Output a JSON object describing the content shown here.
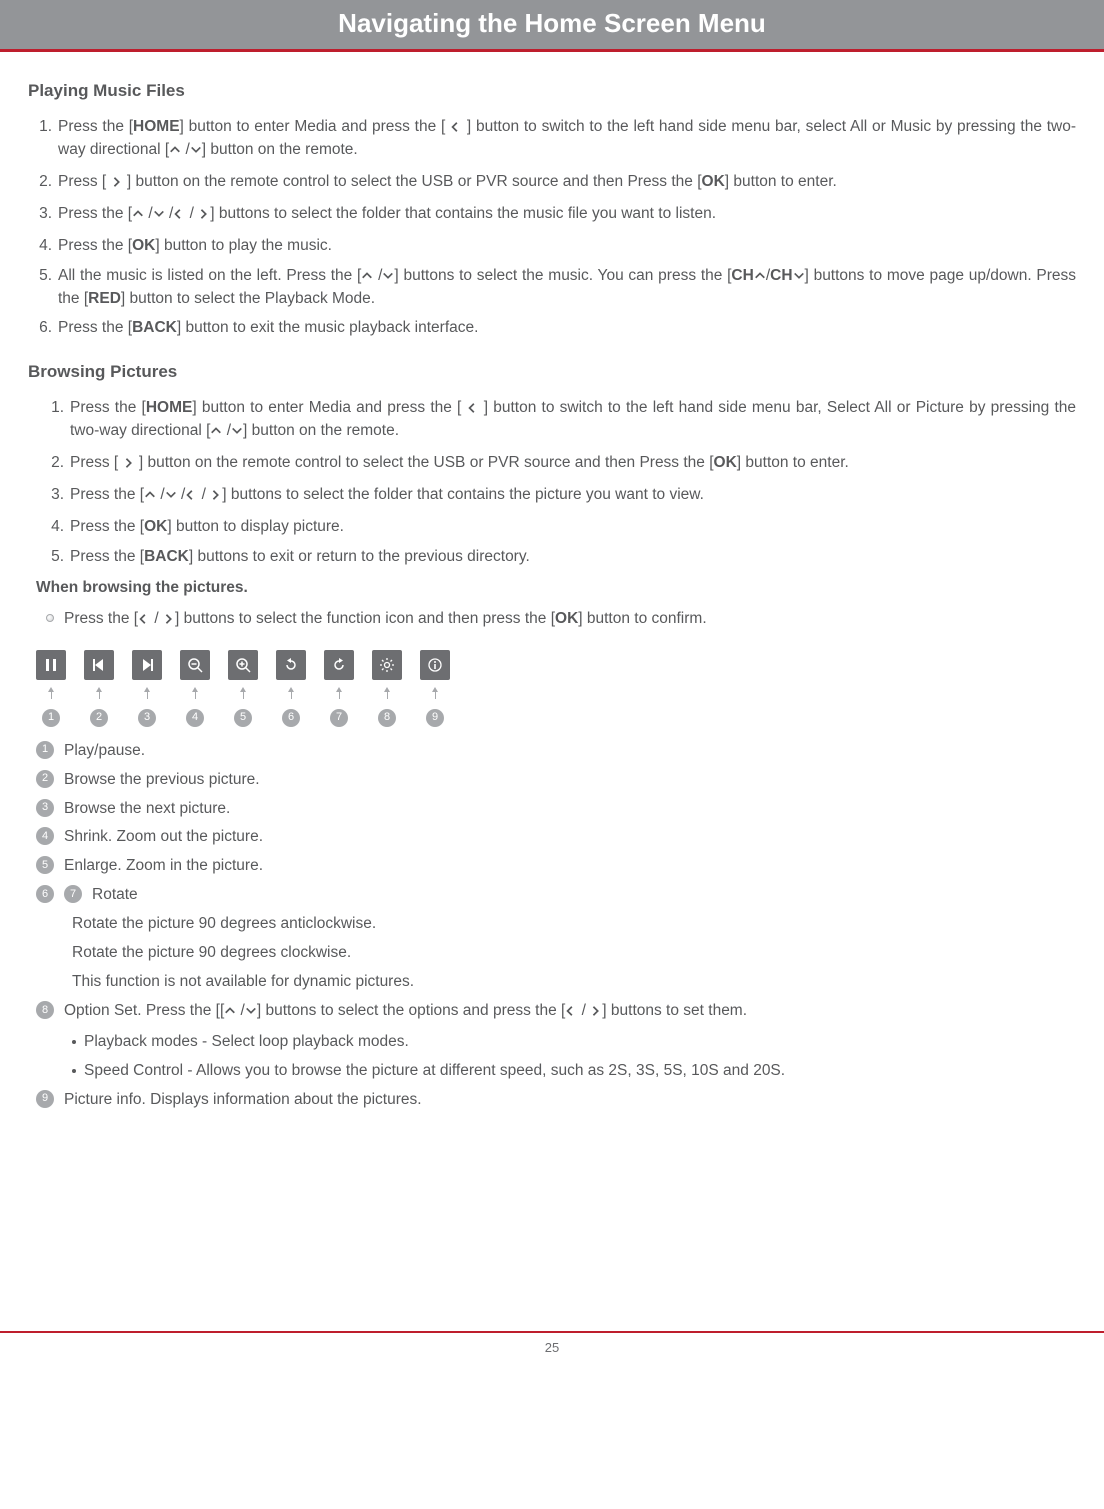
{
  "header": {
    "title": "Navigating the Home Screen Menu"
  },
  "section_music": {
    "title": "Playing Music Files",
    "steps": [
      {
        "pre": "Press the [",
        "b1": "HOME",
        "mid1": "] button to enter Media and press the [ ",
        "icon1": "left",
        "mid2": " ] button to switch to the left hand side menu bar, select All or Music by pressing the two-way directional [",
        "icon2": "up",
        "mid3": " /",
        "icon3": "down",
        "post": "] button on the remote."
      },
      {
        "pre": "Press [ ",
        "icon1": "right",
        "mid1": " ] button on the remote control to select the USB or PVR source and then Press the [",
        "b1": "OK",
        "post": "] button to enter."
      },
      {
        "pre": "Press the [",
        "icon1": "up",
        "mid1": " /",
        "icon2": "down",
        "mid2": " /",
        "icon3": "left",
        "mid3": " / ",
        "icon4": "right",
        "post": "] buttons to select the folder that contains the music file you want to listen."
      },
      {
        "pre": "Press the [",
        "b1": "OK",
        "post": "] button to play the music."
      },
      {
        "pre": "All the music is listed on the left. Press the [",
        "icon1": "up",
        "mid1": " /",
        "icon2": "down",
        "mid2": "] buttons to select the music. You can press the [",
        "b1": "CH",
        "icon3": "up",
        "mid3": "/",
        "b2": "CH",
        "icon4": "down",
        "mid4": "] buttons to move page up/down. Press the [",
        "b3": "RED",
        "post": "] button to select the Playback Mode."
      },
      {
        "pre": "Press the [",
        "b1": "BACK",
        "post": "] button to exit the music playback interface."
      }
    ]
  },
  "section_pics": {
    "title": "Browsing Pictures",
    "steps": [
      {
        "pre": "Press the [",
        "b1": "HOME",
        "mid1": "] button to enter Media and press the [ ",
        "icon1": "left",
        "mid2": " ] button to switch to the left hand side menu bar, Select All or Picture by pressing the two-way directional [",
        "icon2": "up",
        "mid3": " /",
        "icon3": "down",
        "post": "] button on the remote."
      },
      {
        "pre": "Press [ ",
        "icon1": "right",
        "mid1": " ] button on the remote control to select the USB or PVR source and then Press the [",
        "b1": "OK",
        "post": "] button to enter."
      },
      {
        "pre": "Press the  [",
        "icon1": "up",
        "mid1": " /",
        "icon2": "down",
        "mid2": " /",
        "icon3": "left",
        "mid3": " / ",
        "icon4": "right",
        "post": "] buttons to select the folder that contains the picture you want to view."
      },
      {
        "pre": "Press the [",
        "b1": "OK",
        "post": "] button to display picture."
      },
      {
        "pre": "Press the [",
        "b1": "BACK",
        "post": "] buttons to exit or return to the previous directory."
      }
    ],
    "sub_heading": "When browsing the pictures.",
    "bullet": {
      "pre": "Press the [",
      "icon1": "left",
      "mid1": " / ",
      "icon2": "right",
      "mid2": "] buttons to select the function icon and then press the [",
      "b1": "OK",
      "post": "] button to confirm."
    }
  },
  "toolbar_icons": [
    "pause",
    "prev",
    "next",
    "zoom-out",
    "zoom-in",
    "rotate-ccw",
    "rotate-cw",
    "gear",
    "info"
  ],
  "legend": {
    "1": "Play/pause.",
    "2": "Browse the previous picture.",
    "3": "Browse the next picture.",
    "4": "Shrink. Zoom out the picture.",
    "5": "Enlarge. Zoom in the picture.",
    "67_label": "Rotate",
    "67_a": "Rotate the picture 90 degrees anticlockwise.",
    "67_b": "Rotate the picture 90 degrees clockwise.",
    "67_c": "This function is not available for dynamic pictures.",
    "8": {
      "pre": "Option Set. Press the [[",
      "icon1": "up",
      "mid1": " /",
      "icon2": "down",
      "mid2": "] buttons to select the options and press the [",
      "icon3": "left",
      "mid3": " / ",
      "icon4": "right",
      "post": "] buttons to set them."
    },
    "8a": "Playback modes - Select loop playback modes.",
    "8b": "Speed  Control - Allows you to browse the picture at different speed, such as 2S, 3S, 5S, 10S and 20S.",
    "9": "Picture info. Displays information about the pictures."
  },
  "page_number": "25"
}
